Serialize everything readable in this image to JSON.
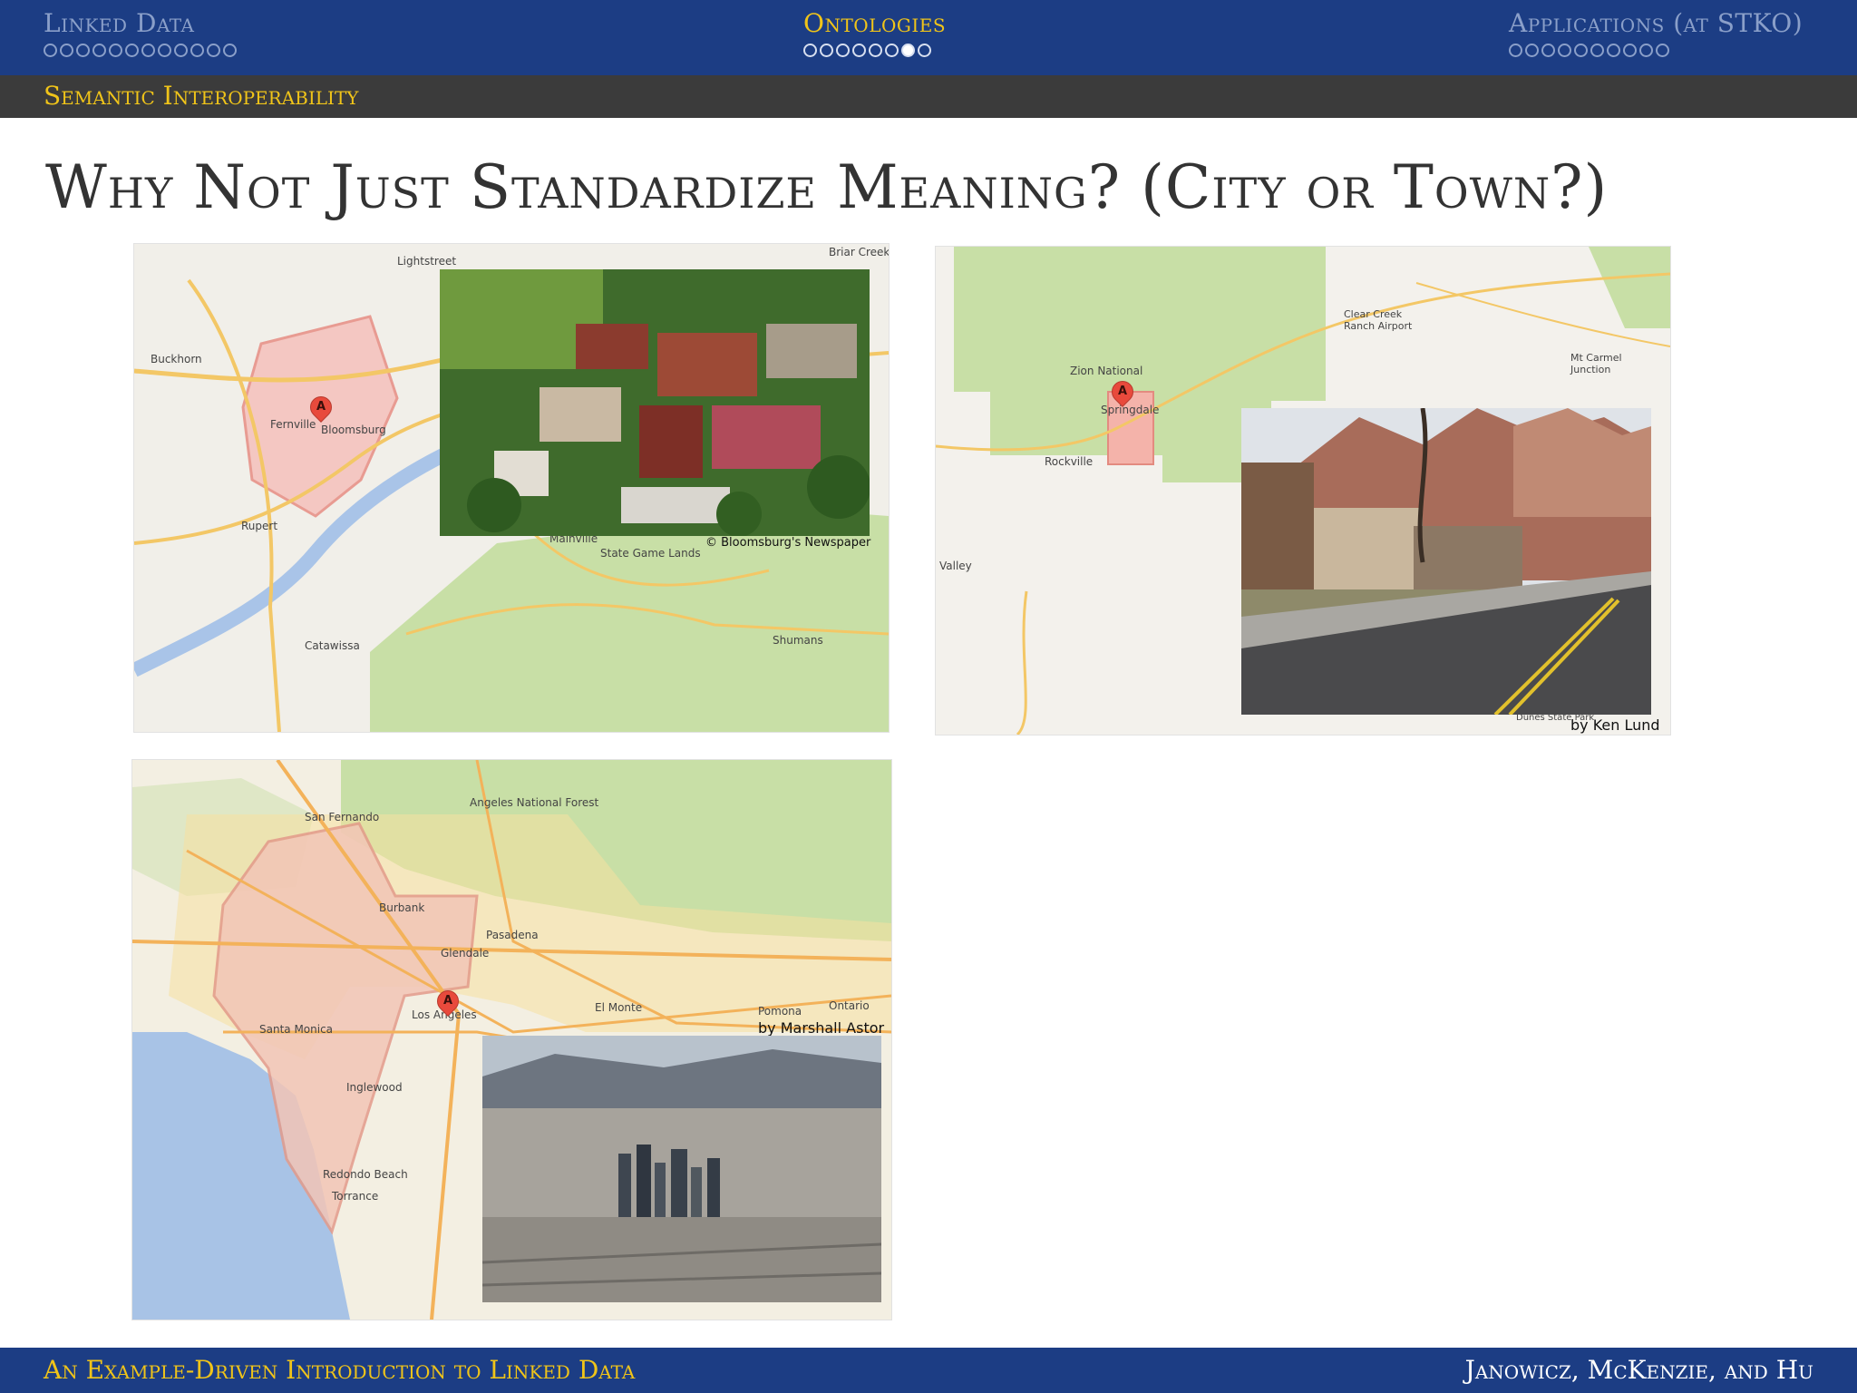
{
  "header": {
    "sections": [
      {
        "label": "Linked Data",
        "dots": 12,
        "filled": -1,
        "active": false
      },
      {
        "label": "Ontologies",
        "dots": 8,
        "filled": 6,
        "active": true
      },
      {
        "label": "Applications (at STKO)",
        "dots": 10,
        "filled": -1,
        "active": false
      }
    ],
    "subsection": "Semantic Interoperability"
  },
  "slide": {
    "title": "Why Not Just Standardize Meaning? (City or Town?)"
  },
  "panels": {
    "bloomsburg": {
      "photo_credit": "© Bloomsburg's Newspaper",
      "marker": "A",
      "places": [
        "Lightstreet",
        "Briar Creek",
        "Buckhorn",
        "Fernville",
        "Bloomsburg",
        "Rupert",
        "Catawissa",
        "Mainville",
        "State Game Lands",
        "Shumans"
      ]
    },
    "springdale": {
      "photo_credit": "by Ken Lund",
      "marker": "A",
      "places": [
        "Zion National",
        "Springdale",
        "Rockville",
        "Clear Creek Ranch Airport",
        "Mt Carmel Junction",
        "Valley",
        "Dunes State Park"
      ]
    },
    "los_angeles": {
      "photo_credit": "by Marshall Astor",
      "marker": "A",
      "places": [
        "Angeles National Forest",
        "San Fernando",
        "Burbank",
        "Glendale",
        "Pasadena",
        "Los Angeles",
        "Santa Monica",
        "Inglewood",
        "Torrance",
        "Pomona",
        "Ontario",
        "El Monte",
        "Redondo Beach"
      ]
    }
  },
  "footer": {
    "left": "An Example-Driven Introduction to Linked Data",
    "right": "Janowicz, McKenzie, and Hu"
  }
}
